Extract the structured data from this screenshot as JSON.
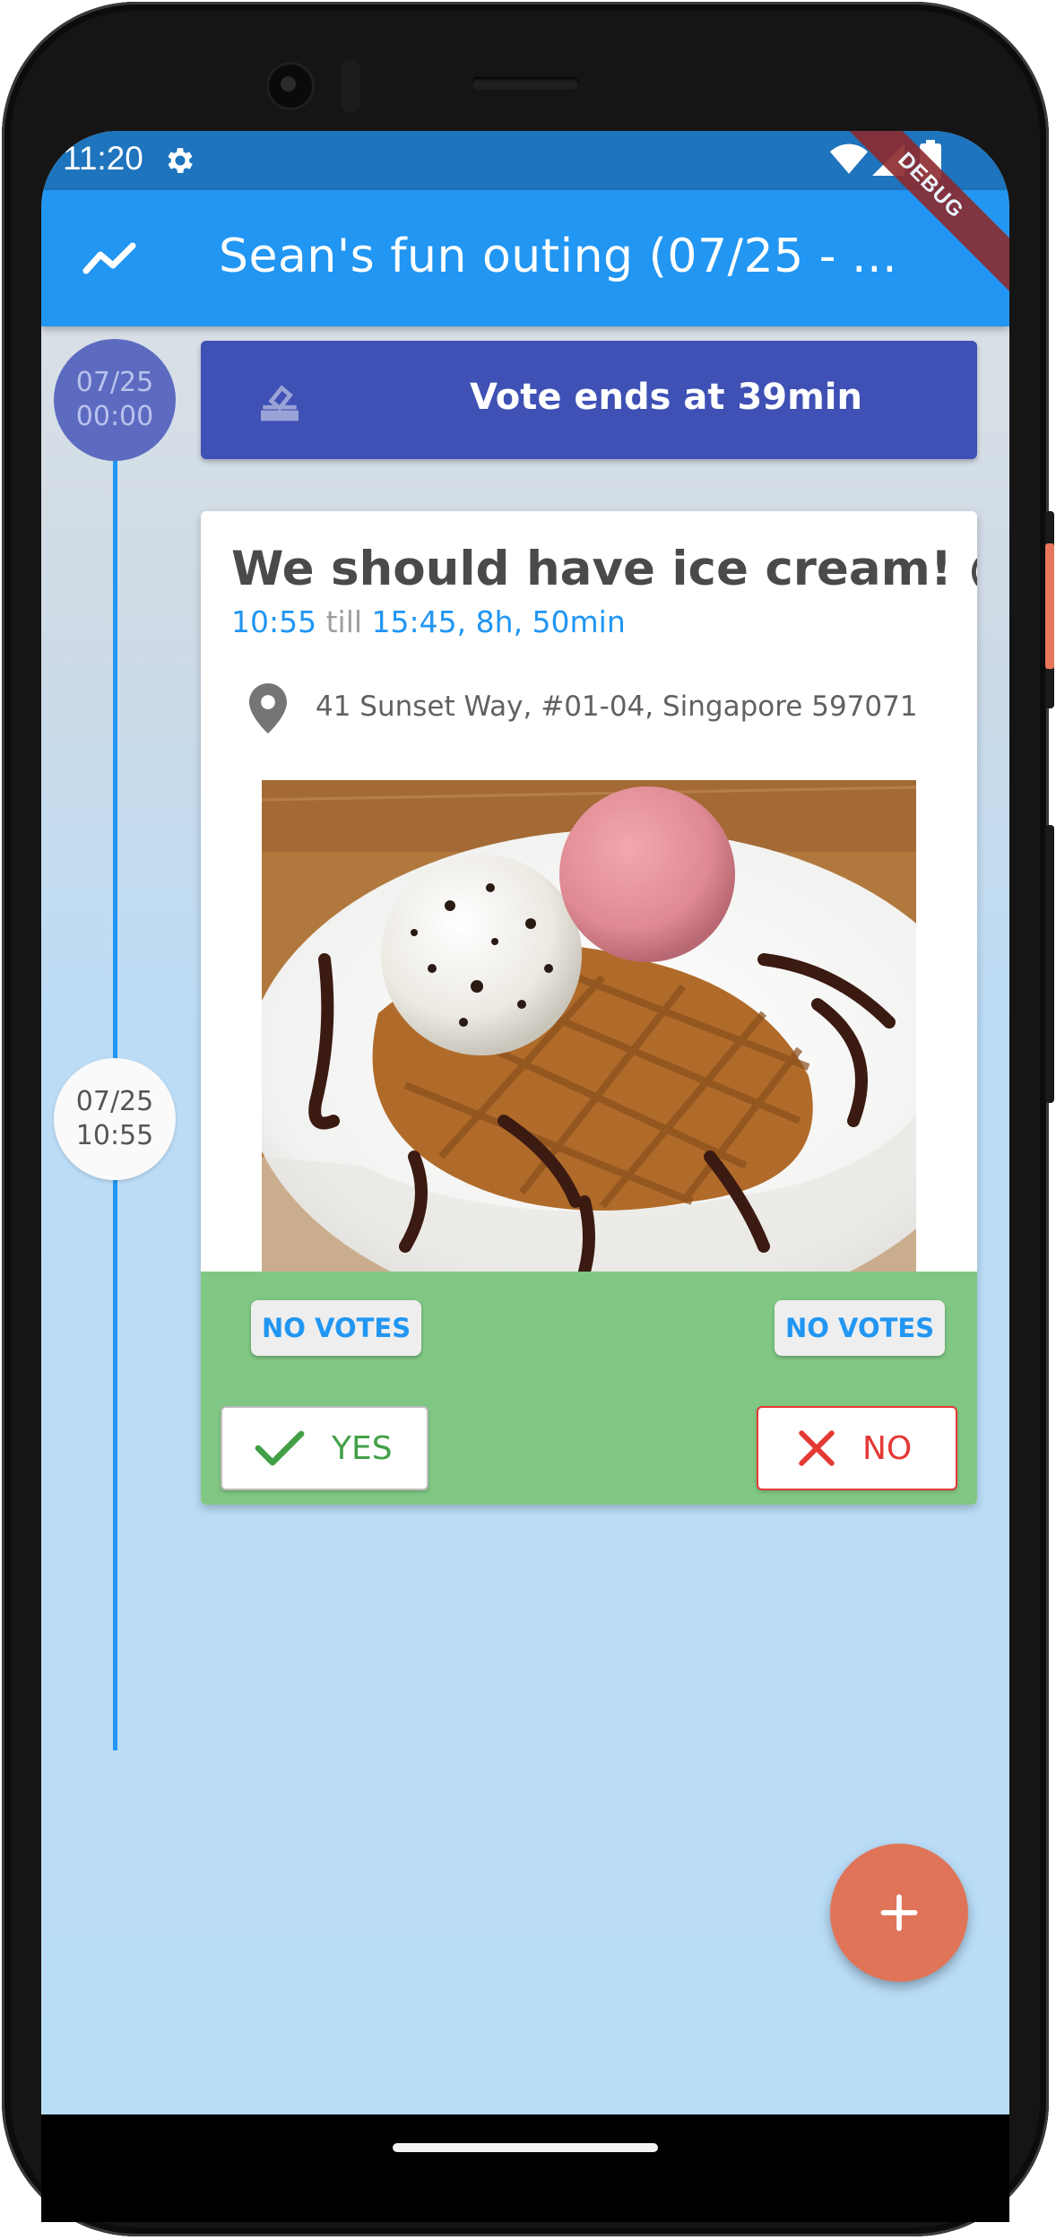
{
  "status_bar": {
    "time": "11:20"
  },
  "app_bar": {
    "title": "Sean's fun outing (07/25 - ...",
    "debug_banner": "DEBUG"
  },
  "timeline": {
    "bubbles": [
      {
        "date": "07/25",
        "time": "00:00"
      },
      {
        "date": "07/25",
        "time": "10:55"
      }
    ]
  },
  "vote_banner": {
    "text": "Vote ends at 39min"
  },
  "event_card": {
    "title": "We should have ice cream!  @...",
    "start_time": "10:55",
    "till": "till",
    "end_time": "15:45",
    "duration": "8h, 50min",
    "address": "41 Sunset Way, #01-04, Singapore 597071",
    "yes_votes_label": "NO VOTES",
    "no_votes_label": "NO VOTES",
    "yes_button": "YES",
    "no_button": "NO"
  },
  "colors": {
    "app_bar": "#2196f3",
    "status_bar": "#1e74bd",
    "vote_banner": "#3f51b5",
    "vote_panel": "#81c784",
    "fab": "#e07458",
    "yes": "#43a047",
    "no": "#e53935"
  },
  "icons": {
    "app_bar": "trending-icon",
    "vote_banner": "ballot-icon",
    "location": "location-pin-icon",
    "yes": "check-icon",
    "no": "close-icon",
    "fab": "plus-icon"
  }
}
